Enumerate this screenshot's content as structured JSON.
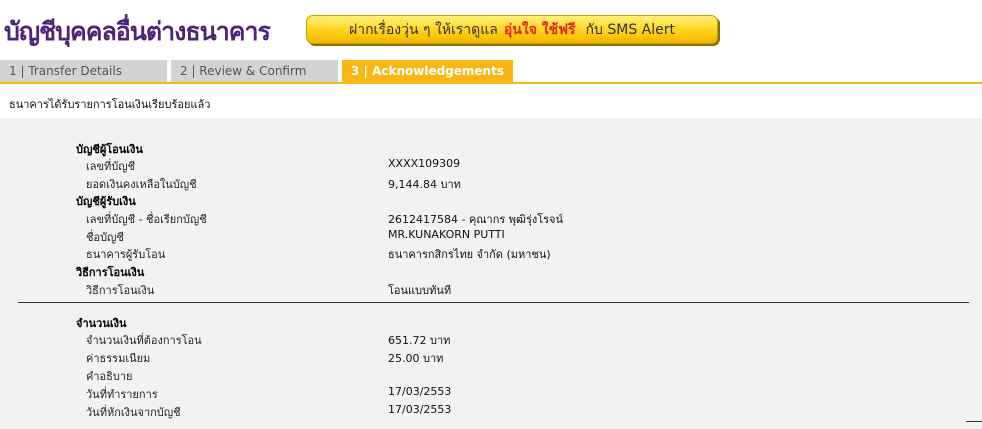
{
  "header": {
    "title": "บัญชีบุคคลอื่นต่างธนาคาร",
    "banner": {
      "text_before": "ฝากเรื่องวุ่น ๆ ให้เราดูแล",
      "highlight": "อุ่นใจ ใช้ฟรี",
      "text_after": "กับ SMS Alert"
    }
  },
  "tabs": [
    {
      "label": "1 | Transfer Details",
      "active": false
    },
    {
      "label": "2 | Review & Confirm",
      "active": false
    },
    {
      "label": "3 | Acknowledgements",
      "active": true
    }
  ],
  "status_message": "ธนาคารได้รับรายการโอนเงินเรียบร้อยแล้ว",
  "from_account": {
    "heading": "บัญชีผู้โอนเงิน",
    "account_no_label": "เลขที่บัญชี",
    "account_no": "XXXX109309",
    "balance_label": "ยอดเงินคงเหลือในบัญชี",
    "balance": "9,144.84 บาท"
  },
  "to_account": {
    "heading": "บัญชีผู้รับเงิน",
    "account_label": "เลขที่บัญชี - ชื่อเรียกบัญชี",
    "account": "2612417584 - คุณากร พุฒิรุ่งโรจน์",
    "name_label": "ชื่อบัญชี",
    "name": "MR.KUNAKORN PUTTI",
    "bank_label": "ธนาคารผู้รับโอน",
    "bank": "ธนาคารกสิกรไทย จำกัด (มหาชน)"
  },
  "method": {
    "heading": "วิธีการโอนเงิน",
    "label": "วิธีการโอนเงิน",
    "value": "โอนแบบทันที"
  },
  "amount": {
    "heading": "จำนวนเงิน",
    "amount_label": "จำนวนเงินที่ต้องการโอน",
    "amount": "651.72 บาท",
    "fee_label": "ค่าธรรมเนียม",
    "fee": "25.00  บาท",
    "desc_label": "คำอธิบาย",
    "desc": "",
    "txn_date_label": "วันที่ทำรายการ",
    "txn_date": "17/03/2553",
    "debit_date_label": "วันที่หักเงินจากบัญชี",
    "debit_date": "17/03/2553"
  }
}
